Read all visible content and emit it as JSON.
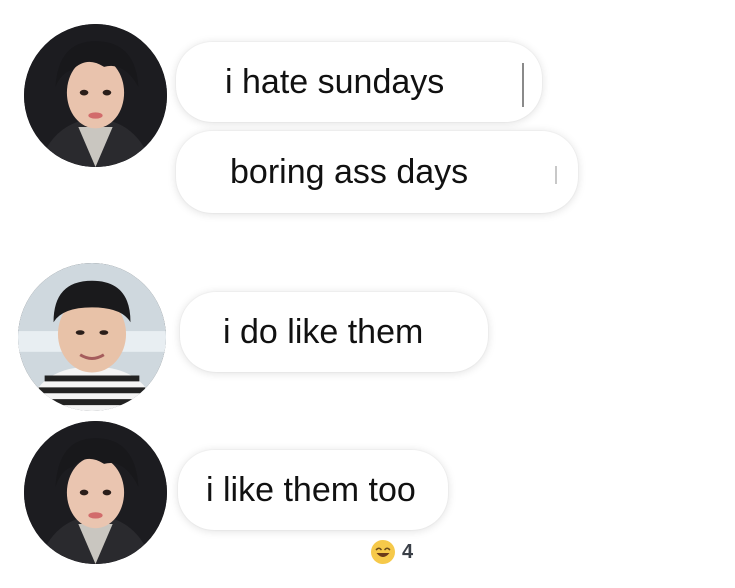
{
  "messages": [
    {
      "text": "i hate sundays"
    },
    {
      "text": "boring ass days"
    },
    {
      "text": "i do like them"
    },
    {
      "text": "i like them too"
    }
  ],
  "reaction": {
    "icon": "laughing-emoji-icon",
    "count": "4"
  },
  "colors": {
    "background": "#ffffff",
    "bubble": "#ffffff",
    "text": "#111111",
    "reaction_count": "#3a3f47"
  }
}
